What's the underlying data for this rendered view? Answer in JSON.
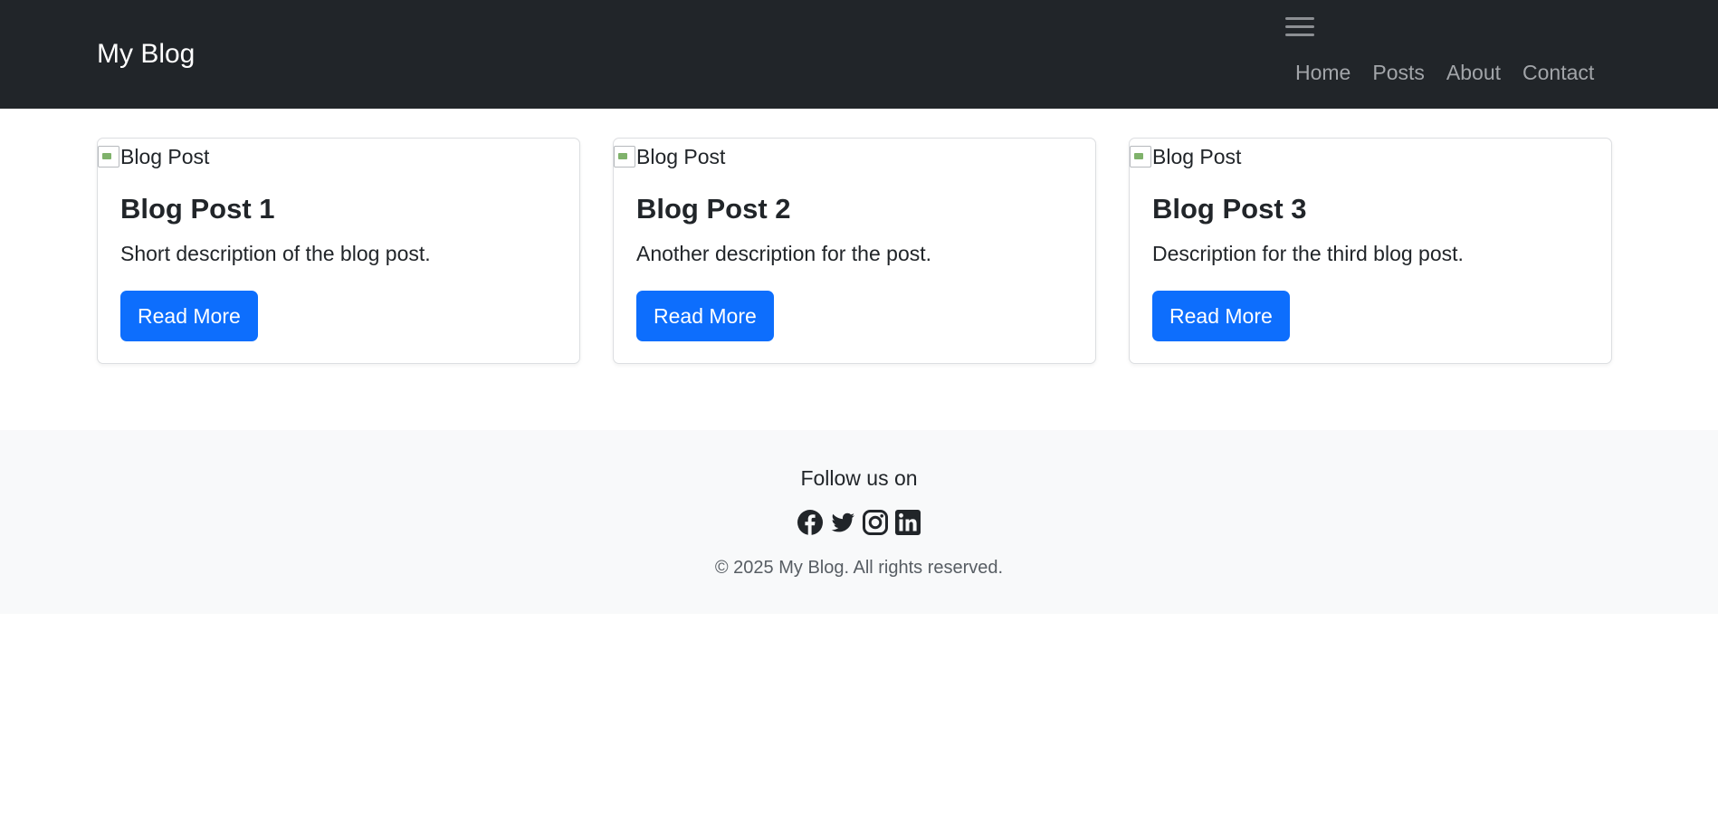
{
  "navbar": {
    "brand": "My Blog",
    "links": [
      "Home",
      "Posts",
      "About",
      "Contact"
    ]
  },
  "posts": [
    {
      "img_alt": "Blog Post",
      "title": "Blog Post 1",
      "text": "Short description of the blog post.",
      "button": "Read More"
    },
    {
      "img_alt": "Blog Post",
      "title": "Blog Post 2",
      "text": "Another description for the post.",
      "button": "Read More"
    },
    {
      "img_alt": "Blog Post",
      "title": "Blog Post 3",
      "text": "Description for the third blog post.",
      "button": "Read More"
    }
  ],
  "footer": {
    "follow": "Follow us on",
    "socials": [
      "facebook-icon",
      "twitter-icon",
      "instagram-icon",
      "linkedin-icon"
    ],
    "copyright": "© 2025 My Blog. All rights reserved."
  },
  "colors": {
    "navbar_bg": "#212529",
    "primary": "#0d6efd",
    "footer_bg": "#f8f9fa"
  }
}
